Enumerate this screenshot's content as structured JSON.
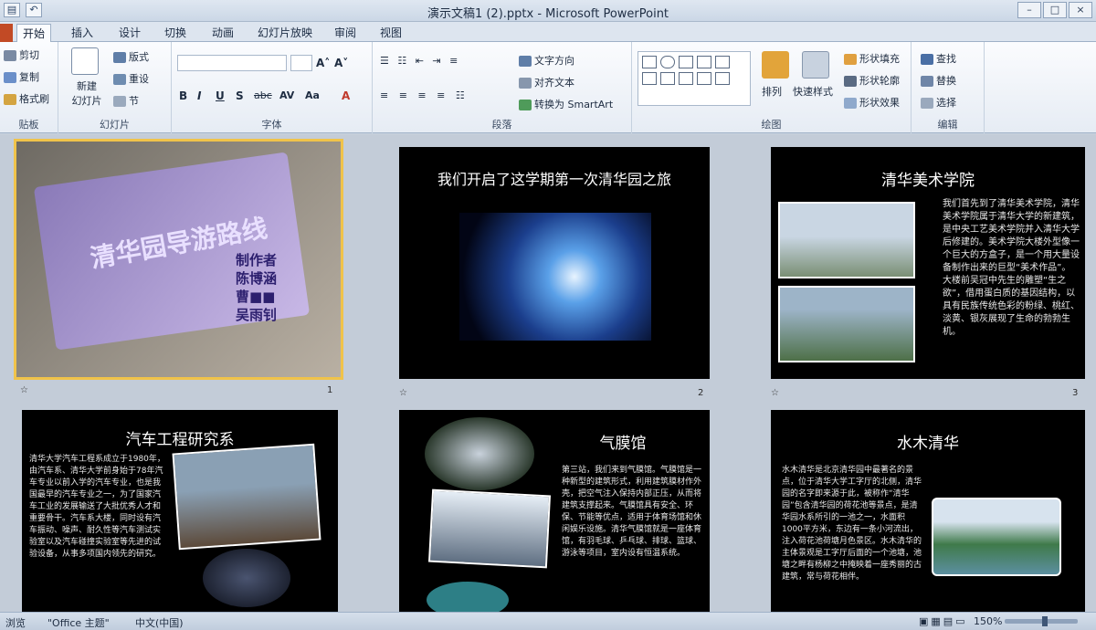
{
  "window": {
    "title": "演示文稿1 (2).pptx - Microsoft PowerPoint",
    "qat": [
      "save-icon",
      "undo-icon"
    ],
    "controls": [
      "minimize-icon",
      "maximize-icon",
      "close-icon"
    ]
  },
  "tabs": [
    {
      "label": "开始",
      "active": true
    },
    {
      "label": "插入"
    },
    {
      "label": "设计"
    },
    {
      "label": "切换"
    },
    {
      "label": "动画"
    },
    {
      "label": "幻灯片放映"
    },
    {
      "label": "审阅"
    },
    {
      "label": "视图"
    }
  ],
  "ribbon": {
    "clipboard": {
      "cut": "剪切",
      "copy": "复制",
      "format_painter": "格式刷",
      "label": "贴板"
    },
    "slides": {
      "new_slide": "新建\n幻灯片",
      "layout": "版式",
      "reset": "重设",
      "section": "节",
      "label": "幻灯片"
    },
    "font": {
      "bold": "B",
      "italic": "I",
      "underline": "U",
      "shadow": "S",
      "strike": "abc",
      "spacing": "AV",
      "case": "Aa",
      "color": "A",
      "grow": "A˄",
      "shrink": "A˅",
      "label": "字体"
    },
    "paragraph": {
      "text_direction": "文字方向",
      "align_text": "对齐文本",
      "smartart": "转换为 SmartArt",
      "label": "段落"
    },
    "drawing": {
      "arrange": "排列",
      "quick_styles": "快速样式",
      "fill": "形状填充",
      "outline": "形状轮廓",
      "effects": "形状效果",
      "label": "绘图"
    },
    "editing": {
      "find": "查找",
      "replace": "替换",
      "select": "选择",
      "label": "编辑"
    }
  },
  "slides": [
    {
      "num": "1",
      "title": "清华园导游路线",
      "authors": [
        "制作者",
        "陈博涵",
        "曹■■",
        "吴雨钊"
      ]
    },
    {
      "num": "2",
      "title": "我们开启了这学期第一次清华园之旅"
    },
    {
      "num": "3",
      "title": "清华美术学院",
      "body": "我们首先到了清华美术学院，清华美术学院属于清华大学的新建筑，是中央工艺美术学院并入清华大学后修建的。美术学院大楼外型像一个巨大的方盒子，是一个用大量设备制作出来的巨型“美术作品”。大楼前吴冠中先生的雕塑“生之欲”，借用蛋白质的基因结构，以具有民族传统色彩的粉绿、桃红、淡黄、银灰展现了生命的勃勃生机。"
    },
    {
      "title": "汽车工程研究系",
      "body": "清华大学汽车工程系成立于1980年，由汽车系、清华大学前身始于78年汽车专业以前入学的汽车专业，也是我国最早的汽车专业之一，为了国家汽车工业的发展输送了大批优秀人才和重要骨干。汽车系大楼，同时设有汽车振动、噪声、耐久性等汽车测试实验室以及汽车碰撞实验室等先进的试验设备，从事多项国内领先的研究。"
    },
    {
      "title": "气膜馆",
      "body": "第三站，我们来到气膜馆。气膜馆是一种新型的建筑形式，利用建筑膜材作外壳，把空气注入保持内部正压，从而将建筑支撑起来。气膜馆具有安全、环保、节能等优点，适用于体育场馆和休闲娱乐设施。清华气膜馆就是一座体育馆，有羽毛球、乒乓球、排球、篮球、游泳等项目，室内设有恒温系统。"
    },
    {
      "title": "水木清华",
      "body": "水木清华是北京清华园中最著名的景点，位于清华大学工字厅的北侧，清华园的名字即来源于此，被称作“清华园”包含清华园的荷花池等景点，是清华园水系所引的一池之一，水面积1000平方米，东边有一条小河流出，注入荷花池荷塘月色景区。水木清华的主体景观是工字厅后面的一个池塘，池塘之畔有杨柳之中掩映着一座秀丽的古建筑，常与荷花相伴。"
    }
  ],
  "status": {
    "view": "浏览",
    "theme": "\"Office 主题\"",
    "language": "中文(中国)",
    "zoom": "150%",
    "zoom_level": 0.55
  },
  "colors": {
    "accent": "#f0c34a",
    "ribbon": "#e6ecf4",
    "slide_bg": "#000000"
  }
}
